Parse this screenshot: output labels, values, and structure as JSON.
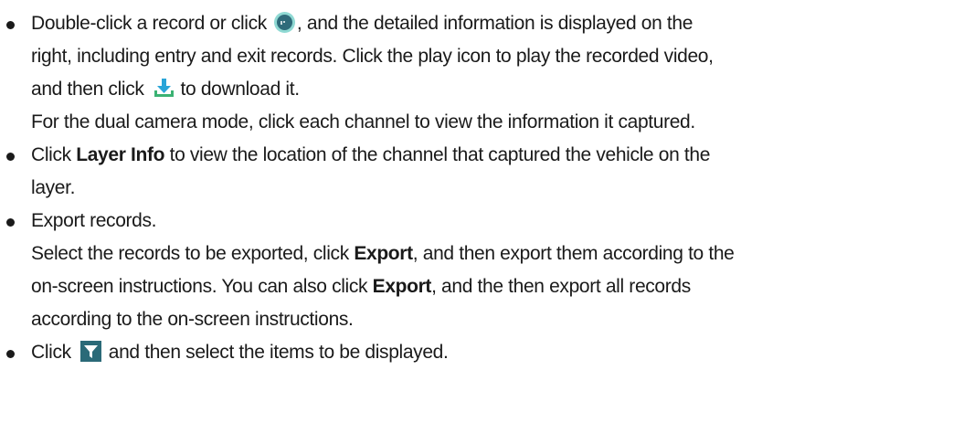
{
  "bullets": [
    {
      "lines": [
        {
          "before_icon": "Double-click a record or click",
          "icon": "more-circle-icon",
          "after_icon": ", and the detailed information is displayed on the"
        },
        {
          "text": "right, including entry and exit records. Click the play icon to play the recorded video,"
        },
        {
          "before_icon": "and then click",
          "icon": "download-icon",
          "after_icon": "to download it."
        },
        {
          "text": "For the dual camera mode, click each channel to view the information it captured."
        }
      ]
    },
    {
      "lines": [
        {
          "before_bold": "Click ",
          "bold": "Layer Info",
          "after_bold": " to view the location of the channel that captured the vehicle on the"
        },
        {
          "text": "layer."
        }
      ]
    },
    {
      "lines": [
        {
          "text": "Export records."
        },
        {
          "before_bold": "Select the records to be exported, click ",
          "bold": "Export",
          "after_bold": ", and then export them according to the"
        },
        {
          "before_bold": "on-screen instructions. You can also click ",
          "bold": "Export",
          "after_bold": ", and the then export all records"
        },
        {
          "text": "according to the on-screen instructions."
        }
      ]
    },
    {
      "lines": [
        {
          "before_icon": "Click",
          "icon": "filter-icon",
          "after_icon": "and then select the items to be displayed."
        }
      ]
    }
  ],
  "icon_colors": {
    "more_outer": "#8fd9d3",
    "more_inner": "#2f6b7a",
    "download_blue": "#2aa5d8",
    "download_green": "#3bb273",
    "filter_bg": "#2b6a78"
  }
}
